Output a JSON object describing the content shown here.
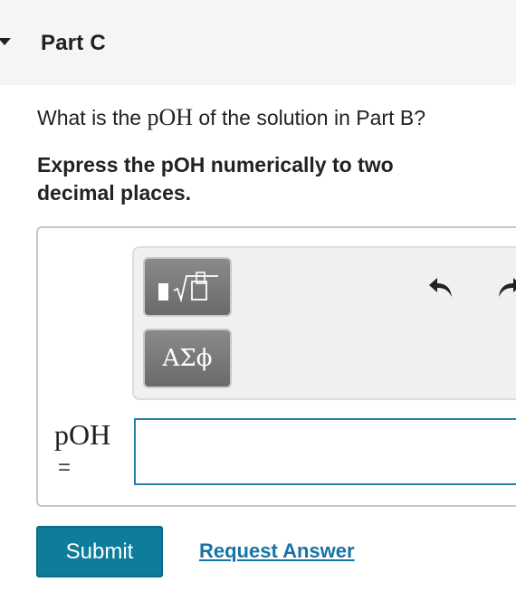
{
  "header": {
    "title": "Part C"
  },
  "question": {
    "prefix": "What is the ",
    "math": "pOH",
    "suffix": " of the solution in Part B?"
  },
  "instruction": "Express the pOH numerically to two decimal places.",
  "toolbar": {
    "templates_icon": "templates-sqrt-icon",
    "greek_label": "ΑΣϕ",
    "undo_icon": "undo-icon",
    "redo_icon": "redo-icon"
  },
  "answer": {
    "variable": "pOH",
    "equals": "=",
    "value": "",
    "placeholder": ""
  },
  "actions": {
    "submit_label": "Submit",
    "request_answer_label": "Request Answer"
  },
  "colors": {
    "header_bg": "#f5f5f5",
    "submit_bg": "#0e7c9b",
    "link": "#1673a8",
    "input_border": "#2a7fa8"
  }
}
